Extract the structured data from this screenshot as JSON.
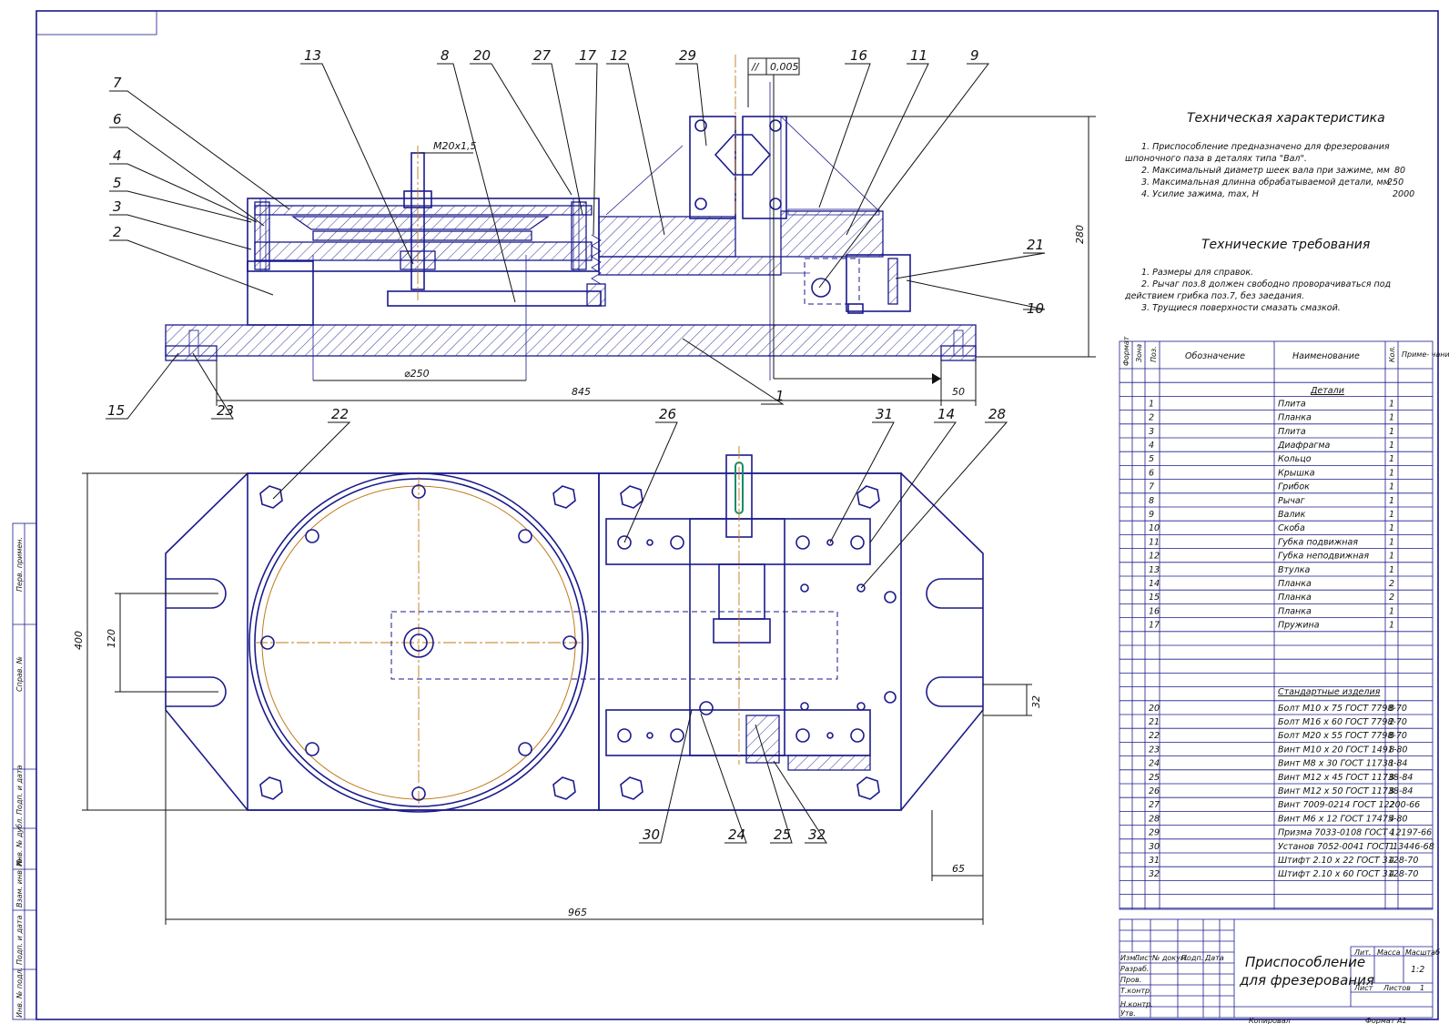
{
  "drawing": {
    "title_line1": "Приспособление",
    "title_line2": "для фрезерования",
    "scale": "1:2",
    "sheet_label": "Листов",
    "sheet_count": "1",
    "lit_label": "Лит.",
    "mass_label": "Масса",
    "scale_label": "Масштаб",
    "list_label": "Лист",
    "copied": "Копировал",
    "format": "Формат А1",
    "tb_headers": [
      "Изм.",
      "Лист",
      "№ докум.",
      "Подп.",
      "Дата"
    ],
    "tb_roles": [
      "Разраб.",
      "Пров.",
      "Т.контр.",
      "",
      "Н.контр.",
      "Утв."
    ]
  },
  "left_margin_labels": [
    "Перв. примен.",
    "Справ. №",
    "Подп. и дата",
    "Инв. № дубл.",
    "Взам. инв. №",
    "Подп. и дата",
    "Инв. № подл."
  ],
  "tech_characteristics": {
    "heading": "Техническая характеристика",
    "lines": [
      {
        "text": "1. Приспособление предназначено для фрезерования",
        "value": ""
      },
      {
        "text": "шпоночного паза в деталях типа \"Вал\".",
        "value": ""
      },
      {
        "text": "2. Максимальный диаметр шеек вала при зажиме, мм",
        "value": "80"
      },
      {
        "text": "3. Максимальная длинна обрабатываемой детали, мм",
        "value": "250"
      },
      {
        "text": "4. Усилие зажима, max, Н",
        "value": "2000"
      }
    ]
  },
  "tech_requirements": {
    "heading": "Технические требования",
    "lines": [
      "1. Размеры для справок.",
      "2. Рычаг поз.8 должен свободно проворачиваться под",
      "действием грибка поз.7, без заедания.",
      "3. Трущиеся поверхности смазать смазкой."
    ]
  },
  "spec_table": {
    "headers": [
      "Формат",
      "Зона",
      "Поз.",
      "Обозначение",
      "Наименование",
      "Кол.",
      "Приме- чание"
    ],
    "section_details": "Детали",
    "section_standard": "Стандартные изделия",
    "details": [
      {
        "pos": "1",
        "name": "Плита",
        "qty": "1"
      },
      {
        "pos": "2",
        "name": "Планка",
        "qty": "1"
      },
      {
        "pos": "3",
        "name": "Плита",
        "qty": "1"
      },
      {
        "pos": "4",
        "name": "Диафрагма",
        "qty": "1"
      },
      {
        "pos": "5",
        "name": "Кольцо",
        "qty": "1"
      },
      {
        "pos": "6",
        "name": "Крышка",
        "qty": "1"
      },
      {
        "pos": "7",
        "name": "Грибок",
        "qty": "1"
      },
      {
        "pos": "8",
        "name": "Рычаг",
        "qty": "1"
      },
      {
        "pos": "9",
        "name": "Валик",
        "qty": "1"
      },
      {
        "pos": "10",
        "name": "Скоба",
        "qty": "1"
      },
      {
        "pos": "11",
        "name": "Губка подвижная",
        "qty": "1"
      },
      {
        "pos": "12",
        "name": "Губка неподвижная",
        "qty": "1"
      },
      {
        "pos": "13",
        "name": "Втулка",
        "qty": "1"
      },
      {
        "pos": "14",
        "name": "Планка",
        "qty": "2"
      },
      {
        "pos": "15",
        "name": "Планка",
        "qty": "2"
      },
      {
        "pos": "16",
        "name": "Планка",
        "qty": "1"
      },
      {
        "pos": "17",
        "name": "Пружина",
        "qty": "1"
      }
    ],
    "standard": [
      {
        "pos": "20",
        "name": "Болт М10 х 75 ГОСТ 7798-70",
        "qty": "8"
      },
      {
        "pos": "21",
        "name": "Болт М16 х 60 ГОСТ 7798-70",
        "qty": "2"
      },
      {
        "pos": "22",
        "name": "Болт М20 х 55 ГОСТ 7798-70",
        "qty": "8"
      },
      {
        "pos": "23",
        "name": "Винт М10 х 20 ГОСТ 1491-80",
        "qty": "8"
      },
      {
        "pos": "24",
        "name": "Винт М8 х 30 ГОСТ 11738-84",
        "qty": "1"
      },
      {
        "pos": "25",
        "name": "Винт М12 х 45 ГОСТ 11738-84",
        "qty": "8"
      },
      {
        "pos": "26",
        "name": "Винт М12 х 50 ГОСТ 11738-84",
        "qty": "8"
      },
      {
        "pos": "27",
        "name": "Винт 7009-0214 ГОСТ 12200-66",
        "qty": "2"
      },
      {
        "pos": "28",
        "name": "Винт М6 х 12 ГОСТ 17475-80",
        "qty": "4"
      },
      {
        "pos": "29",
        "name": "Призма 7033-0108 ГОСТ 12197-66",
        "qty": "4"
      },
      {
        "pos": "30",
        "name": "Установ 7052-0041 ГОСТ 13446-68",
        "qty": "1"
      },
      {
        "pos": "31",
        "name": "Штифт 2.10 х 22 ГОСТ 3128-70",
        "qty": "4"
      },
      {
        "pos": "32",
        "name": "Штифт 2.10 х 60 ГОСТ 3128-70",
        "qty": "4"
      }
    ]
  },
  "dimensions": {
    "thread": "М20х1,5",
    "diameter": "⌀250",
    "length_845": "845",
    "length_50": "50",
    "height_280": "280",
    "width_400": "400",
    "slot_120": "120",
    "slot_32": "32",
    "length_965": "965",
    "length_65": "65",
    "parallel_tol": "0,005",
    "parallel_sym": "//"
  },
  "position_callouts": {
    "front": [
      "13",
      "8",
      "20",
      "27",
      "17",
      "12",
      "29",
      "16",
      "11",
      "9",
      "7",
      "6",
      "4",
      "5",
      "3",
      "2",
      "21",
      "10",
      "1",
      "15",
      "23"
    ],
    "plan": [
      "22",
      "26",
      "31",
      "14",
      "28",
      "30",
      "24",
      "25",
      "32"
    ]
  },
  "colors": {
    "line": "#1a1a8c",
    "axis": "#c27a1a",
    "text": "#111111",
    "accent_green": "#1a8a6a"
  }
}
